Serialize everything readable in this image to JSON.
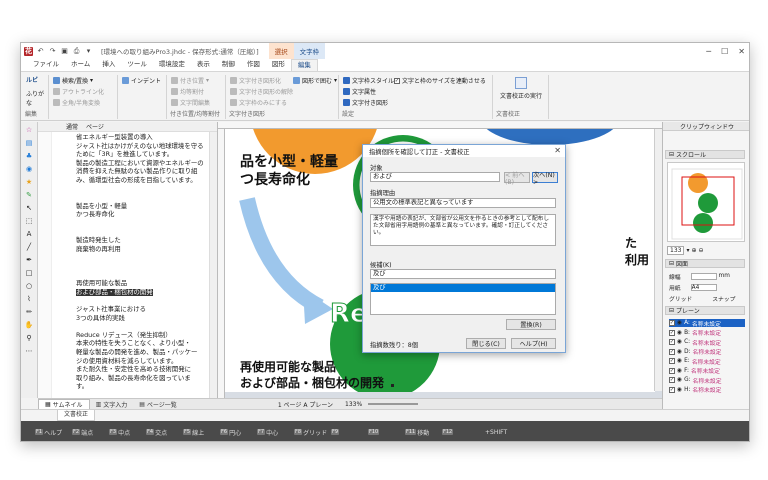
{
  "window": {
    "title": "[環境への取り組みPro3.jhdc - 保存形式:通常（圧縮）]",
    "context_tabs": [
      "選択",
      "文字枠"
    ],
    "menu": [
      "ファイル",
      "ホーム",
      "挿入",
      "ツール",
      "環境設定",
      "表示",
      "制御",
      "作図",
      "図形",
      "編集"
    ],
    "active_menu": "編集"
  },
  "ribbon": {
    "ruby": "ルビ",
    "furigana": "ふりがな",
    "group_edit": "編集",
    "search_replace": "検索/置換",
    "outline": "アウトライン化",
    "zenkaku": "全角/半角変換",
    "indent": "インデント",
    "fuki_ichi": "付き位置",
    "equal_alloc": "均等割付",
    "group_position": "付き位置/均等割付",
    "bunshi_inter": "文字間編集",
    "text_figure": "文字付き図形化",
    "text_figure_remove": "文字付き図形の解除",
    "text_only": "文字枠のみにする",
    "shape_wrap": "図形で囲む",
    "group_textfig": "文字付き図形",
    "frame_style": "文字枠スタイル",
    "frame_attr": "文字属性",
    "text_fig2": "文字付き図形",
    "link_size": "文字と枠のサイズを連動させる",
    "group_settings": "設定",
    "proofread_run": "文書校正の実行",
    "group_proofread": "文書校正"
  },
  "outline": {
    "header": [
      "通常",
      "ページ"
    ],
    "lines": [
      "省エネルギー型装置の導入",
      "ジャスト社はかけがえのない地球環境を守る",
      "ために「3R」を推進しています。",
      "製品の製造工程において資源やエネルギーの",
      "消費を抑えた無駄のない製品作りに取り組",
      "み、循環型社会の形成を目指しています。",
      "",
      "",
      "製品を小型・軽量",
      "かつ長寿命化",
      "",
      "",
      "製造時発生した",
      "廃棄物の再利用",
      "",
      "",
      "",
      "再使用可能な製品",
      "および部品・梱包材の開発",
      "",
      "ジャスト社事業における",
      "3つの具体的実践",
      "",
      "Reduce リデュース（発生抑制）",
      "本来の特性を失うことなく、より小型・",
      "軽量な製品の開発を進め、製品・パッケー",
      "ジの使用資材料を減らしています。",
      "また耐久性・安定性を高める技術開発に",
      "取り組み、製品の長寿命化を図っていま",
      "す。"
    ],
    "selected_index": 18
  },
  "canvas": {
    "text1": "品を小型・軽量",
    "text2": "つ長寿命化",
    "text3": "再使用可能な製品",
    "text4": "および部品・梱包材の開発",
    "text_right1": "た",
    "text_right2": "利用",
    "logo_re": "Re",
    "logo_num": "3"
  },
  "status_tabs": [
    "サムネイル",
    "文字入力",
    "ページ一覧"
  ],
  "status": {
    "page": "1 ページ A プレーン",
    "zoom": "133%"
  },
  "right_pane": {
    "clip_window": "クリップウィンドウ",
    "scroll": "スクロール",
    "zoom_value": "133",
    "drawing_pane": "図面",
    "width_label": "線幅",
    "width_unit": "mm",
    "paper_label": "用紙",
    "paper_value": "A4",
    "grid_label": "グリッド",
    "snap_label": "スナップ",
    "plane_label": "プレーン",
    "layers": [
      {
        "code": "A:",
        "name": "名称未設定"
      },
      {
        "code": "B:",
        "name": "名称未設定"
      },
      {
        "code": "C:",
        "name": "名称未設定"
      },
      {
        "code": "D:",
        "name": "名称未設定"
      },
      {
        "code": "E:",
        "name": "名称未設定"
      },
      {
        "code": "F:",
        "name": "名称未設定"
      },
      {
        "code": "G:",
        "name": "名称未設定"
      },
      {
        "code": "H:",
        "name": "名称未設定"
      }
    ]
  },
  "doc_tab": "文書校正",
  "fkeys": [
    {
      "k": "F1",
      "label": "ヘルプ"
    },
    {
      "k": "F2",
      "label": "端点"
    },
    {
      "k": "F3",
      "label": "中点"
    },
    {
      "k": "F4",
      "label": "交点"
    },
    {
      "k": "F5",
      "label": "線上"
    },
    {
      "k": "F6",
      "label": "円心"
    },
    {
      "k": "F7",
      "label": "中心"
    },
    {
      "k": "F8",
      "label": "グリッド"
    },
    {
      "k": "F9",
      "label": ""
    },
    {
      "k": "F10",
      "label": ""
    },
    {
      "k": "F11",
      "label": "移動"
    },
    {
      "k": "F12",
      "label": ""
    }
  ],
  "fkeys_shift": "+SHIFT",
  "dialog": {
    "title": "指摘個所を確認して訂正 - 文書校正",
    "target_label": "対象",
    "target_value": "および",
    "prev_button": "< 前へ(B)",
    "next_button": "次へ(N) >",
    "reason_label": "指摘理由",
    "reason_value": "公用文の標準表記と異なっています",
    "explanation": "漢字や用語の表記が、文部省が公用文を作るときの参考として配布した文部省用字用語例の基準と異なっています。確認・訂正してください。",
    "candidate_label": "候補(K)",
    "candidate_input": "及び",
    "candidate_selected": "及び",
    "replace_button": "置換(R)",
    "count_label": "指摘数残り：",
    "count_value": "8個",
    "close_button": "閉じる(C)",
    "help_button": "ヘルプ(H)"
  }
}
